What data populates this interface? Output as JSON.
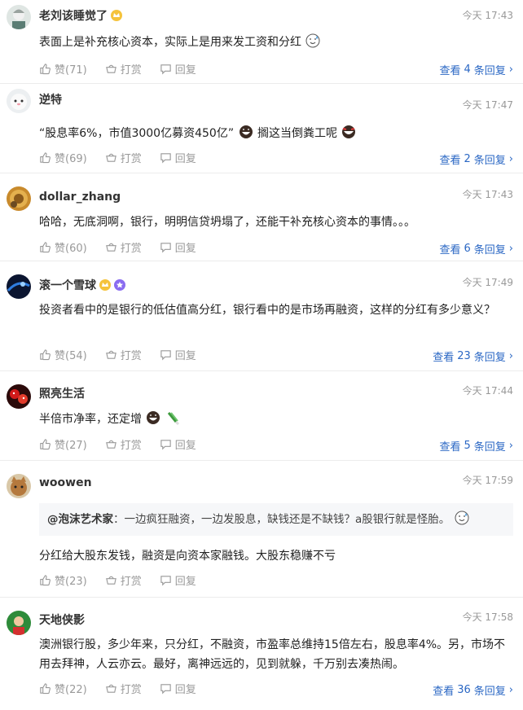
{
  "comments": [
    {
      "username": "老刘该睡觉了",
      "time": "今天 17:43",
      "text": "表面上是补充核心资本，实际上是用来发工资和分红",
      "likes": "赞(71)",
      "reward": "打赏",
      "reply": "回复",
      "replies_prefix": "查看",
      "replies_count": "4",
      "replies_suffix": "条回复",
      "emoji": [
        "sweat-smile-emoji"
      ],
      "badges": [
        "crown-badge-icon"
      ]
    },
    {
      "username": "逆特",
      "time": "今天 17:47",
      "text_parts": [
        "“股息率6%，市值3000亿募资450亿”",
        " 搁这当倒粪工呢"
      ],
      "likes": "赞(69)",
      "reward": "打赏",
      "reply": "回复",
      "replies_prefix": "查看",
      "replies_count": "2",
      "replies_suffix": "条回复"
    },
    {
      "username": "dollar_zhang",
      "time": "今天 17:43",
      "text": "哈哈，无底洞啊，银行，明明信贷坍塌了，还能干补充核心资本的事情。。。",
      "likes": "赞(60)",
      "reward": "打赏",
      "reply": "回复",
      "replies_prefix": "查看",
      "replies_count": "6",
      "replies_suffix": "条回复"
    },
    {
      "username": "滚一个雪球",
      "time": "今天 17:49",
      "text": "投资者看中的是银行的低估值高分红，银行看中的是市场再融资，这样的分红有多少意义？",
      "likes": "赞(54)",
      "reward": "打赏",
      "reply": "回复",
      "replies_prefix": "查看",
      "replies_count": "23",
      "replies_suffix": "条回复"
    },
    {
      "username": "照亮生活",
      "time": "今天 17:44",
      "text": "半倍市净率，还定增",
      "likes": "赞(27)",
      "reward": "打赏",
      "reply": "回复",
      "replies_prefix": "查看",
      "replies_count": "5",
      "replies_suffix": "条回复"
    },
    {
      "username": "woowen",
      "time": "今天 17:59",
      "quote_user": "@泡沫艺术家",
      "quote_text": "：一边疯狂融资，一边发股息，缺钱还是不缺钱？a股银行就是怪胎。",
      "text": "分红给大股东发钱，融资是向资本家融钱。大股东稳赚不亏",
      "likes": "赞(23)",
      "reward": "打赏",
      "reply": "回复"
    },
    {
      "username": "天地侠影",
      "time": "今天 17:58",
      "text": "澳洲银行股，多少年来，只分红，不融资，市盈率总维持15倍左右，股息率4%。另，市场不用去拜神，人云亦云。最好，离神远远的，见到就躲，千万别去凑热闹。",
      "likes": "赞(22)",
      "reward": "打赏",
      "reply": "回复",
      "replies_prefix": "查看",
      "replies_count": "36",
      "replies_suffix": "条回复"
    }
  ],
  "colors": {
    "link": "#2a67c4",
    "meta": "#999999",
    "divider": "#ececec",
    "quote_bg": "#f6f7f9"
  }
}
